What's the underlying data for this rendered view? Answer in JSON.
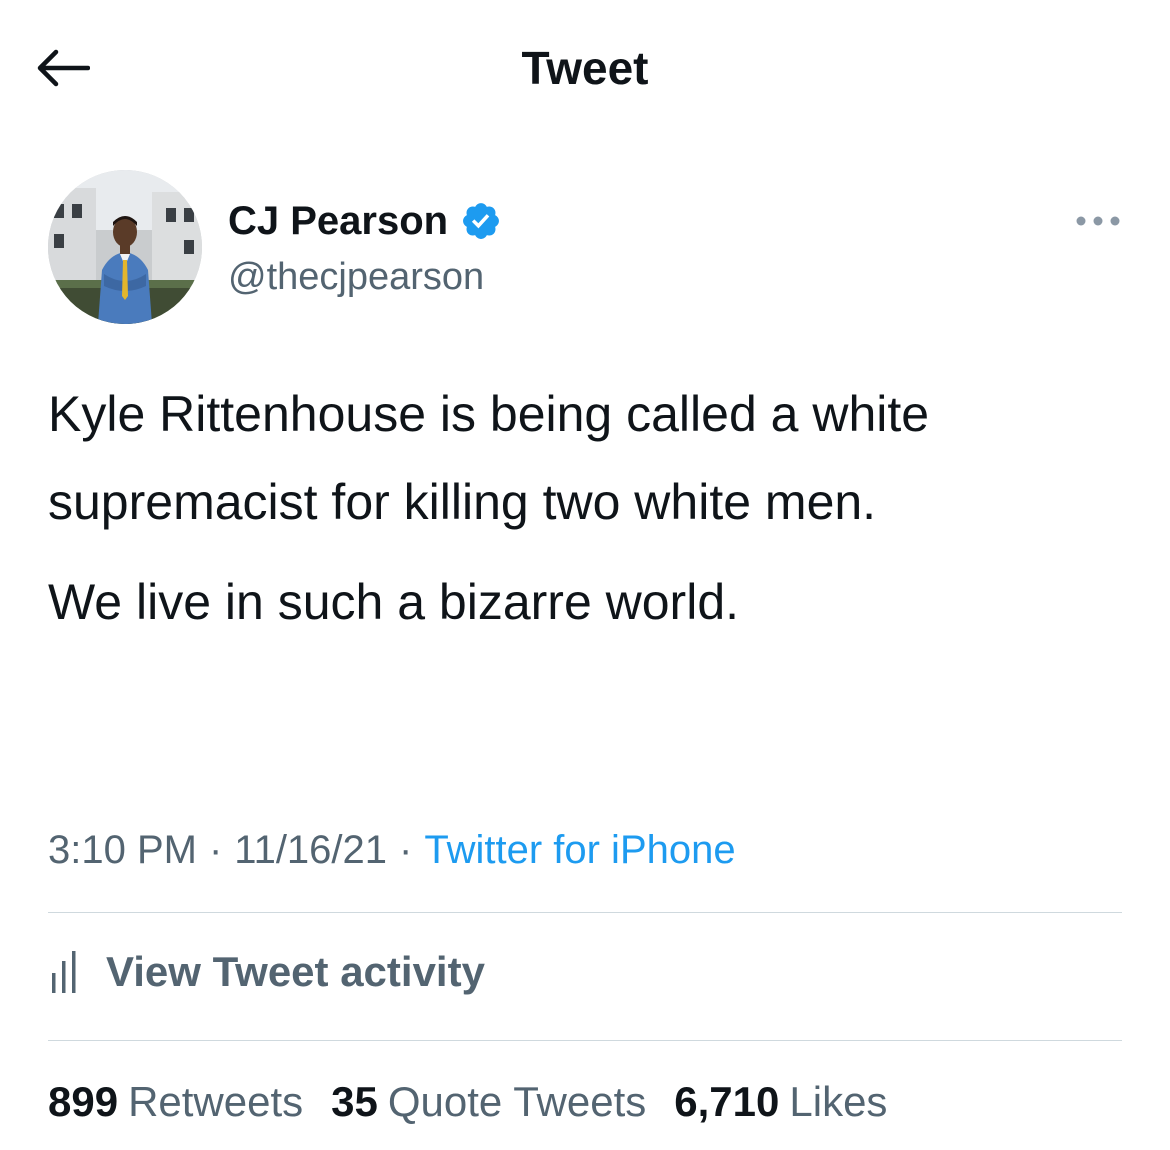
{
  "header": {
    "title": "Tweet",
    "back_icon": "arrow-left-icon"
  },
  "author": {
    "display_name": "CJ Pearson",
    "handle": "@thecjpearson",
    "verified_icon": "verified-badge-icon",
    "more_icon": "more-options-icon"
  },
  "tweet": {
    "paragraphs": [
      "Kyle Rittenhouse is being called a white supremacist for killing two white men.",
      "We live in such a bizarre world."
    ],
    "time": "3:10 PM",
    "separator": "·",
    "date": "11/16/21",
    "source": "Twitter for iPhone"
  },
  "activity": {
    "label": "View Tweet activity",
    "icon": "bar-chart-icon"
  },
  "stats": {
    "retweets_count": "899",
    "retweets_label": "Retweets",
    "quotes_count": "35",
    "quotes_label": "Quote Tweets",
    "likes_count": "6,710",
    "likes_label": "Likes"
  },
  "colors": {
    "accent": "#1d9bf0",
    "secondary_text": "#536471",
    "primary_text": "#0f1419",
    "divider": "#cfd9de"
  }
}
